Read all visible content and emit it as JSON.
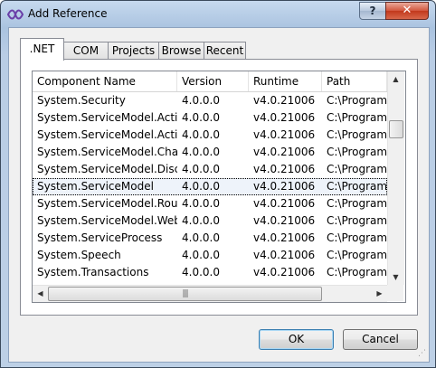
{
  "window": {
    "title": "Add Reference",
    "help_label": "?",
    "close_label": "✕"
  },
  "tabs": [
    {
      "label": ".NET",
      "active": true
    },
    {
      "label": "COM",
      "active": false
    },
    {
      "label": "Projects",
      "active": false
    },
    {
      "label": "Browse",
      "active": false
    },
    {
      "label": "Recent",
      "active": false
    }
  ],
  "list": {
    "columns": [
      "Component Name",
      "Version",
      "Runtime",
      "Path"
    ],
    "rows": [
      [
        "System.Security",
        "4.0.0.0",
        "v4.0.21006",
        "C:\\Program"
      ],
      [
        "System.ServiceModel.Acti...",
        "4.0.0.0",
        "v4.0.21006",
        "C:\\Program"
      ],
      [
        "System.ServiceModel.Acti...",
        "4.0.0.0",
        "v4.0.21006",
        "C:\\Program"
      ],
      [
        "System.ServiceModel.Cha...",
        "4.0.0.0",
        "v4.0.21006",
        "C:\\Program"
      ],
      [
        "System.ServiceModel.Disc...",
        "4.0.0.0",
        "v4.0.21006",
        "C:\\Program"
      ],
      [
        "System.ServiceModel",
        "4.0.0.0",
        "v4.0.21006",
        "C:\\Program"
      ],
      [
        "System.ServiceModel.Rout...",
        "4.0.0.0",
        "v4.0.21006",
        "C:\\Program"
      ],
      [
        "System.ServiceModel.Web",
        "4.0.0.0",
        "v4.0.21006",
        "C:\\Program"
      ],
      [
        "System.ServiceProcess",
        "4.0.0.0",
        "v4.0.21006",
        "C:\\Program"
      ],
      [
        "System.Speech",
        "4.0.0.0",
        "v4.0.21006",
        "C:\\Program"
      ],
      [
        "System.Transactions",
        "4.0.0.0",
        "v4.0.21006",
        "C:\\Program"
      ]
    ],
    "selected_index": 5
  },
  "scrollbars": {
    "up_arrow": "▲",
    "down_arrow": "▼",
    "left_arrow": "◀",
    "right_arrow": "▶",
    "h_thumb_grip": "|||"
  },
  "buttons": {
    "ok_label": "OK",
    "cancel_label": "Cancel"
  }
}
